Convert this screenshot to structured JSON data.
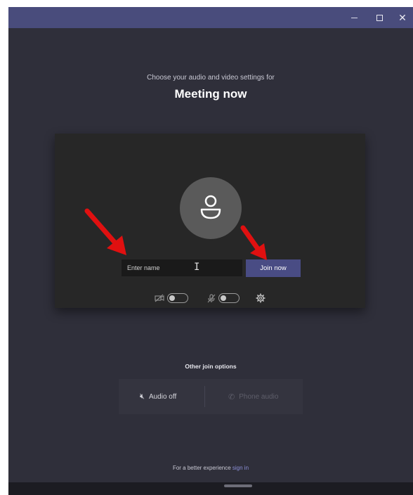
{
  "window": {
    "title_bar_color": "#494c7c",
    "controls": [
      "minimize-icon",
      "maximize-icon",
      "close-icon"
    ],
    "close_glyph": "✕"
  },
  "prejoin": {
    "subtitle": "Choose your audio and video settings for",
    "title": "Meeting now",
    "name_placeholder": "Enter name",
    "join_label": "Join now",
    "camera_toggle": "off",
    "mic_toggle": "off"
  },
  "other_options": {
    "heading": "Other join options",
    "audio_off_label": "Audio off",
    "phone_audio_label": "Phone audio"
  },
  "footer": {
    "prefix": "For a better experience",
    "link": "sign in"
  },
  "colors": {
    "background": "#2f2f3a",
    "accent": "#494c84",
    "annotation_arrow": "#e01010"
  }
}
